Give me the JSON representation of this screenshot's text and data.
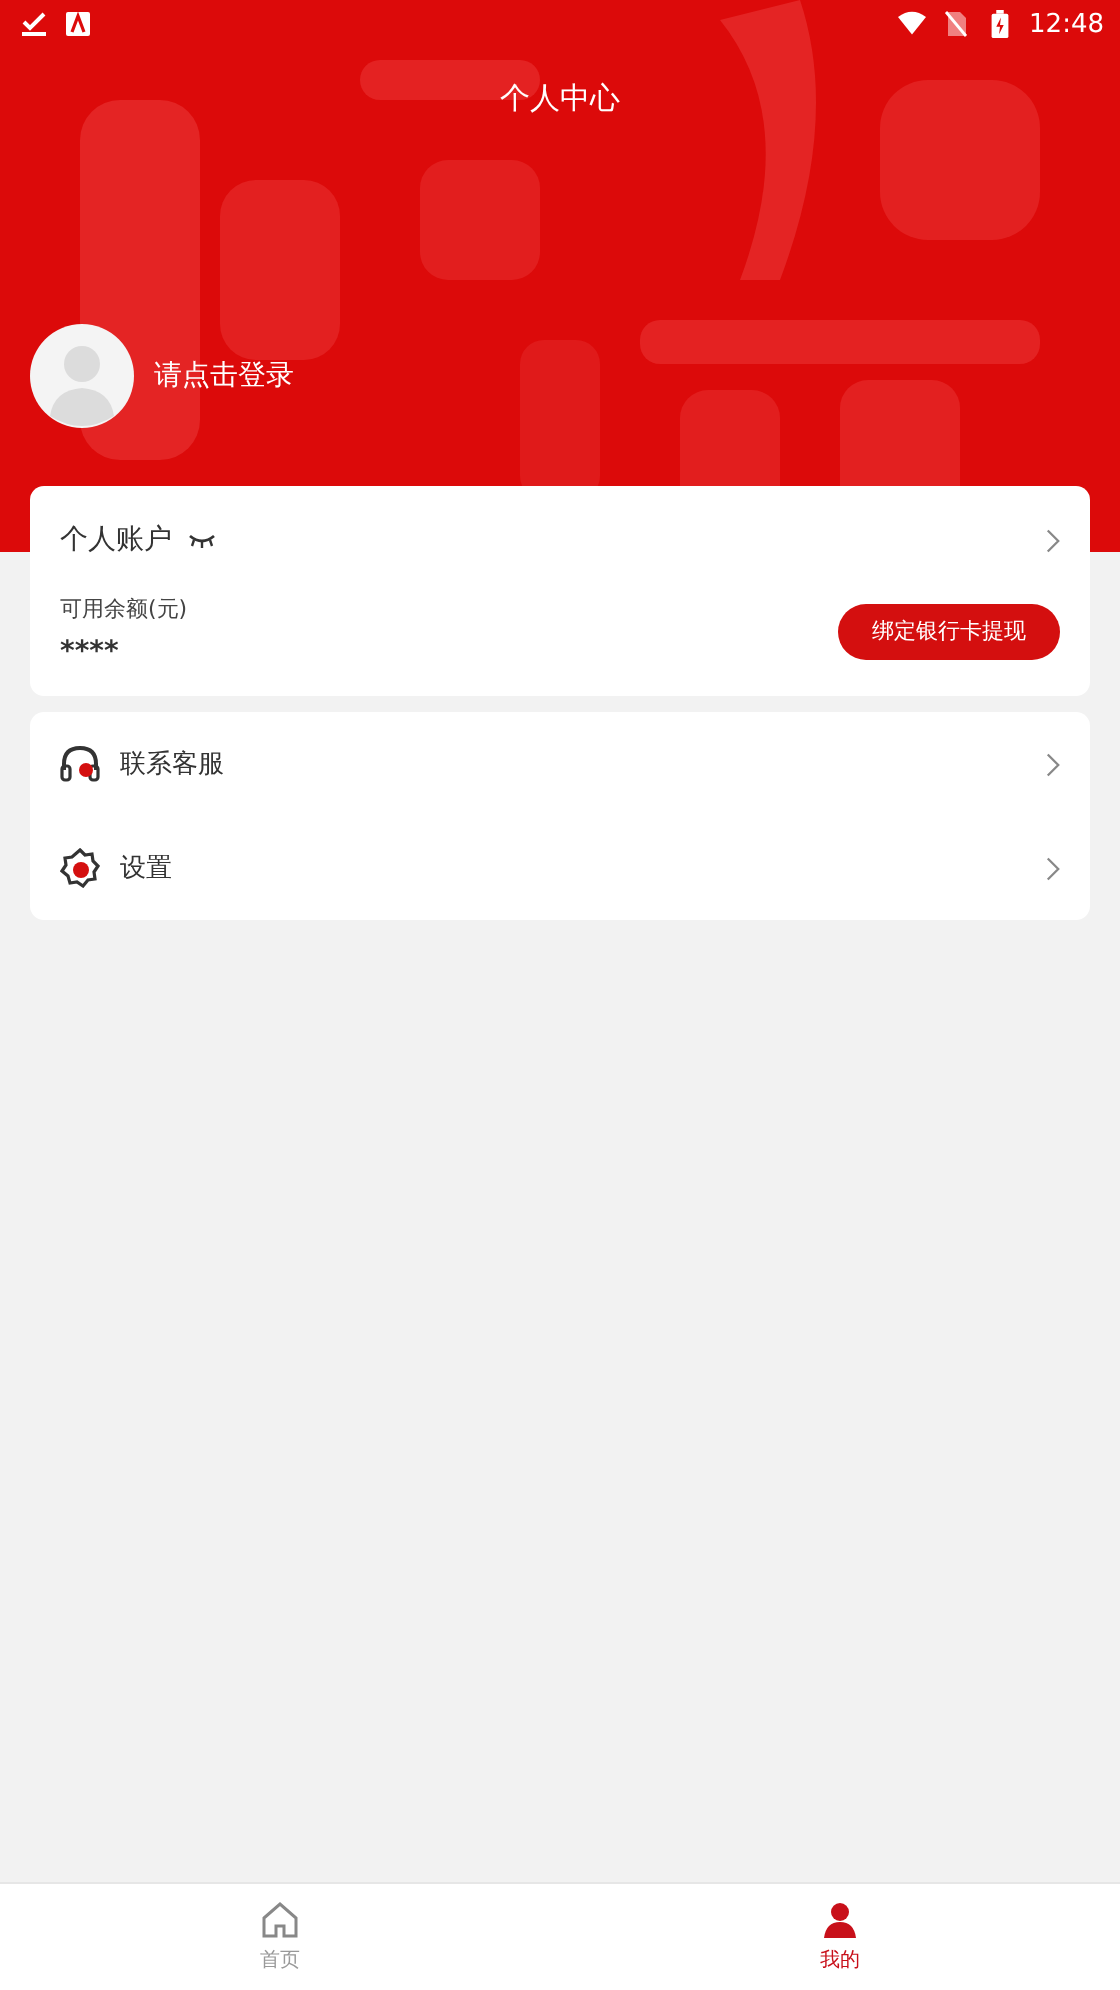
{
  "status_bar": {
    "time": "12:48"
  },
  "header": {
    "title": "个人中心",
    "login_prompt": "请点击登录"
  },
  "account_card": {
    "title": "个人账户",
    "balance_label": "可用余额(元)",
    "balance": "****",
    "withdraw_button": "绑定银行卡提现"
  },
  "menu": [
    {
      "kind": "service",
      "label": "联系客服"
    },
    {
      "kind": "settings",
      "label": "设置"
    }
  ],
  "tab_bar": [
    {
      "kind": "home",
      "label": "首页",
      "selected": false
    },
    {
      "kind": "me",
      "label": "我的",
      "selected": true
    }
  ]
}
